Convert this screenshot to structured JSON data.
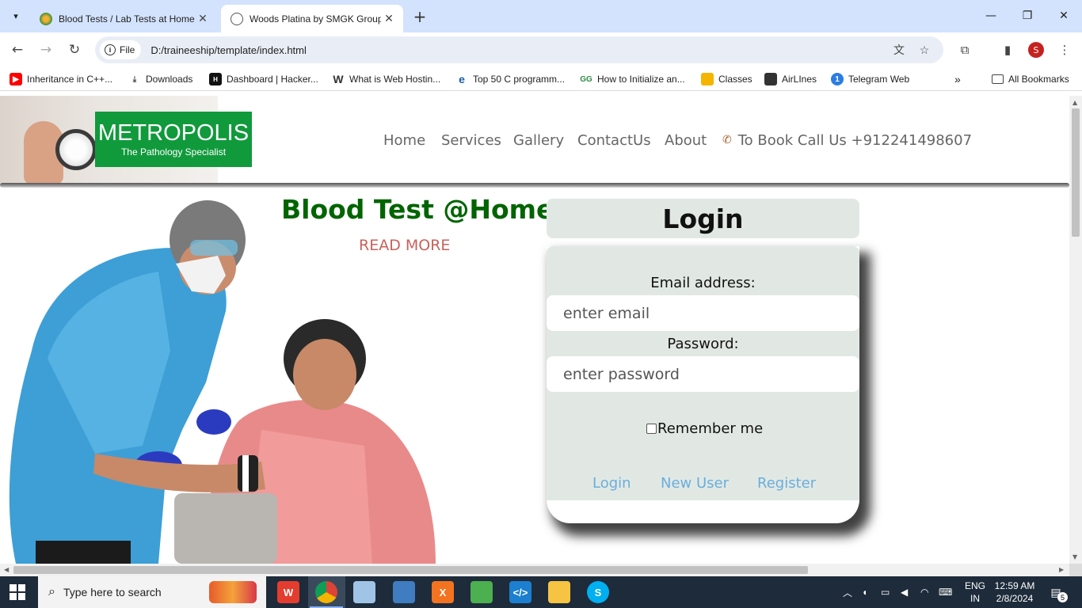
{
  "browser": {
    "tabs": [
      {
        "title": "Blood Tests / Lab Tests at Home",
        "active": false
      },
      {
        "title": "Woods Platina by SMGK Group",
        "active": true
      }
    ],
    "address": {
      "chip_label": "File",
      "url": "D:/traineeship/template/index.html"
    },
    "bookmarks": [
      {
        "label": "Inheritance in C++...",
        "icon": "youtube-icon"
      },
      {
        "label": "Downloads",
        "icon": "download-icon"
      },
      {
        "label": "Dashboard | Hacker...",
        "icon": "hackerrank-icon"
      },
      {
        "label": "What is Web Hostin...",
        "icon": "w-icon"
      },
      {
        "label": "Top 50 C programm...",
        "icon": "edureka-icon"
      },
      {
        "label": "How to Initialize an...",
        "icon": "gfg-icon"
      },
      {
        "label": "Classes",
        "icon": "classroom-icon"
      },
      {
        "label": "AirLInes",
        "icon": "airlines-icon"
      },
      {
        "label": "Telegram Web",
        "icon": "telegram-icon"
      }
    ],
    "all_bookmarks_label": "All Bookmarks",
    "profile_initial": "S",
    "accent": "#d3e3fd"
  },
  "site": {
    "logo": {
      "name": "METROPOLIS",
      "tagline": "The Pathology Specialist",
      "color": "#119a3c"
    },
    "nav": [
      "Home",
      "Services",
      "Gallery",
      "ContactUs",
      "About"
    ],
    "book_call": "To Book Call Us +912241498607",
    "promo": {
      "title": "Blood Test @Home",
      "link": "READ MORE",
      "title_color": "#006400",
      "link_color": "#c8625c"
    },
    "login": {
      "heading": "Login",
      "email_label": "Email address:",
      "email_placeholder": "enter email",
      "password_label": "Password:",
      "password_placeholder": "enter password",
      "remember_label": "Remember me",
      "remember_checked": false,
      "links": [
        "Login",
        "New User",
        "Register"
      ],
      "link_color": "#6aaedb"
    }
  },
  "taskbar": {
    "search_placeholder": "Type here to search",
    "lang_line1": "ENG",
    "lang_line2": "IN",
    "time": "12:59 AM",
    "date": "2/8/2024",
    "notification_count": "5"
  }
}
